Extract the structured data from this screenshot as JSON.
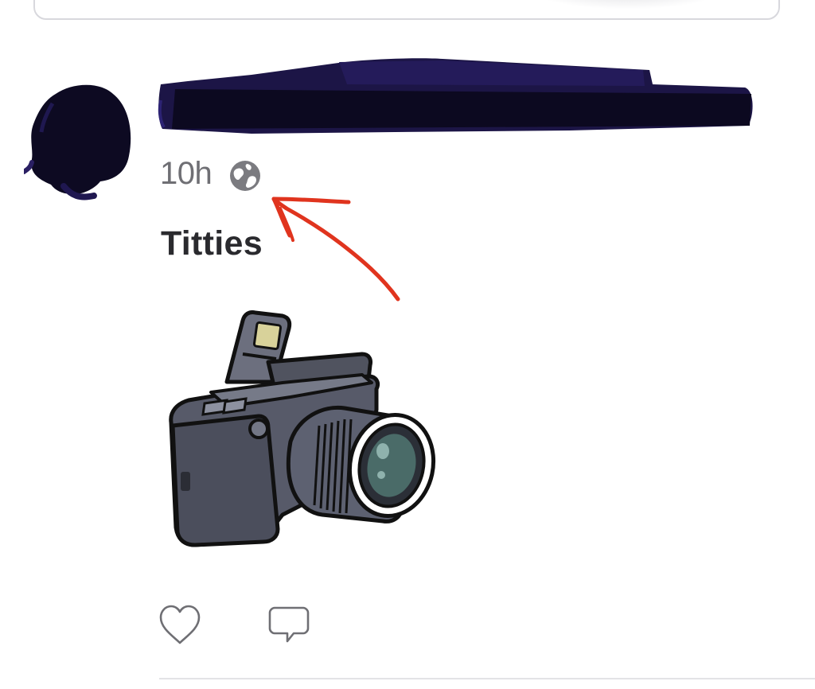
{
  "post": {
    "timestamp": "10h",
    "visibility_icon": "globe-icon",
    "text": "Titties",
    "media": "camera-sticker"
  },
  "actions": {
    "like_icon": "heart-icon",
    "comment_icon": "comment-icon"
  },
  "colors": {
    "redaction": "#1c1546",
    "annotation": "#e0341e",
    "timestamp": "#6f6f74",
    "text": "#2a2a2e"
  }
}
